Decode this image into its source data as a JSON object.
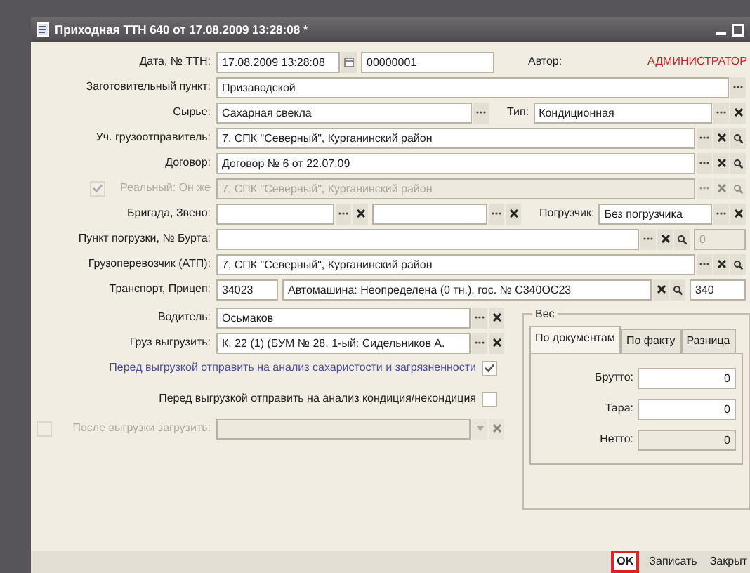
{
  "window": {
    "title": "Приходная ТТН 640 от 17.08.2009 13:28:08 *"
  },
  "header": {
    "date_label": "Дата, № ТТН:",
    "date": "17.08.2009 13:28:08",
    "number": "00000001",
    "author_label": "Автор:",
    "author": "АДМИНИСТРАТОР"
  },
  "rows": [
    {
      "label": "Заготовительный пункт:",
      "fields": [
        {
          "value": "Призаводской",
          "disabled": false,
          "choose": true
        }
      ]
    },
    {
      "label": "Сырье:",
      "fields": [
        {
          "value": "Сахарная свекла",
          "disabled": false,
          "choose": true
        },
        {
          "label": "Тип:",
          "value": "Кондиционная",
          "disabled": false,
          "choose": true,
          "clear": true
        }
      ]
    },
    {
      "label": "Уч. грузоотправитель:",
      "fields": [
        {
          "value": "7, СПК \"Северный\", Курганинский район",
          "disabled": false,
          "choose": true,
          "clear": true,
          "search": true
        }
      ]
    },
    {
      "label": "Договор:",
      "fields": [
        {
          "value": "Договор № 6 от 22.07.09",
          "disabled": false,
          "choose": true,
          "clear": true,
          "search": true
        }
      ]
    },
    {
      "label": "Реальный: Он же",
      "checkbox": {
        "checked": true,
        "disabled": true
      },
      "fields": [
        {
          "value": "7, СПК \"Северный\", Курганинский район",
          "disabled": true,
          "choose": true,
          "clear": true,
          "search": true
        }
      ]
    },
    {
      "label": "Бригада, Звено:",
      "fields": [
        {
          "disabled": false,
          "choose": true,
          "clear": true
        },
        {
          "disabled": false,
          "choose": true,
          "clear": true
        },
        {
          "label": "Погрузчик:",
          "value": "Без погрузчика",
          "disabled": false,
          "choose": true,
          "clear": true
        }
      ]
    },
    {
      "label": "Пункт погрузки, № Бурта:",
      "fields": [
        {
          "disabled": false,
          "choose": true,
          "clear": true,
          "search": true
        },
        {
          "value": "0",
          "disabled": true
        }
      ]
    },
    {
      "label": "Грузоперевозчик (АТП):",
      "fields": [
        {
          "value": "7, СПК \"Северный\", Курганинский район",
          "disabled": false,
          "choose": true,
          "clear": true,
          "search": true
        }
      ]
    },
    {
      "label": "Транспорт, Прицеп:",
      "fields": [
        {
          "value": "34023",
          "disabled": false
        },
        {
          "value": "Автомашина: Неопределена (0 тн.), гос. № С340ОС23",
          "disabled": false,
          "clear": true,
          "search": true
        },
        {
          "value": "340",
          "disabled": false
        }
      ]
    }
  ],
  "left_rows": [
    {
      "label": "Водитель:",
      "fields": [
        {
          "value": "Осьмаков",
          "disabled": false,
          "choose": true,
          "clear": true
        }
      ]
    },
    {
      "label": "Груз выгрузить:",
      "fields": [
        {
          "value": "К. 22 (1) (БУМ № 28, 1-ый: Сидельников А.",
          "disabled": false,
          "choose": true,
          "clear": true
        }
      ]
    }
  ],
  "checks": [
    {
      "label": "Перед выгрузкой отправить на анализ сахаристости и загрязненности",
      "checked": true,
      "emphasized": true
    },
    {
      "label": "Перед выгрузкой отправить на анализ кондиция/некондиция",
      "checked": false,
      "emphasized": false
    }
  ],
  "after_unload": {
    "label": "После выгрузки загрузить:",
    "checked": false,
    "disabled": true,
    "dropdown": true,
    "clear": true
  },
  "weight": {
    "title": "Вес",
    "tabs": [
      {
        "label": "По документам",
        "selected": true
      },
      {
        "label": "По факту",
        "selected": false
      },
      {
        "label": "Разница",
        "selected": false
      }
    ],
    "rows": [
      {
        "label": "Брутто:",
        "value": "0",
        "disabled": false
      },
      {
        "label": "Тара:",
        "value": "0",
        "disabled": false
      },
      {
        "label": "Нетто:",
        "value": "0",
        "disabled": true
      }
    ]
  },
  "footer": [
    {
      "label": "OK",
      "default": true
    },
    {
      "label": "Записать",
      "default": false
    },
    {
      "label": "Закрыт",
      "default": false
    }
  ]
}
